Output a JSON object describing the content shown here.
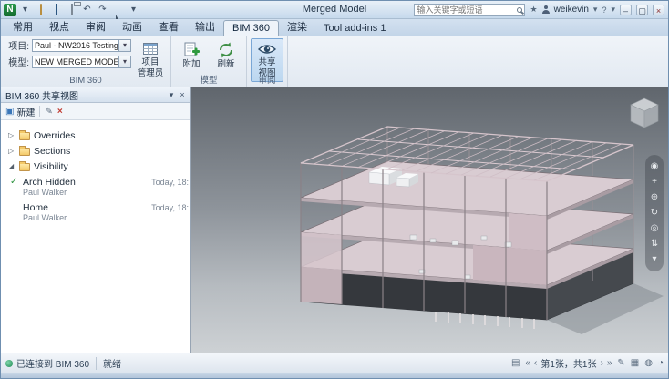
{
  "window": {
    "title": "Merged Model",
    "search_placeholder": "输入关键字或短语",
    "user": "weikevin",
    "help": "?",
    "logo": "N"
  },
  "tabs": {
    "items": [
      "常用",
      "视点",
      "审阅",
      "动画",
      "查看",
      "输出",
      "BIM 360",
      "渲染",
      "Tool add-ins 1"
    ]
  },
  "ribbon": {
    "project_label": "项目:",
    "project_value": "Paul - NW2016 Testing",
    "model_label": "模型:",
    "model_value": "NEW MERGED MODEL",
    "admin": {
      "line1": "项目",
      "line2": "管理员"
    },
    "attach": "附加",
    "refresh": "刷新",
    "shared": {
      "line1": "共享",
      "line2": "视图"
    },
    "groups": {
      "bim360": "BIM 360",
      "model": "模型",
      "review": "审阅"
    }
  },
  "panel": {
    "title": "BIM 360 共享视图",
    "new_label": "新建",
    "folders": [
      "Overrides",
      "Sections",
      "Visibility"
    ],
    "views": [
      {
        "name": "Arch Hidden",
        "author": "Paul Walker",
        "time": "Today, 18:"
      },
      {
        "name": "Home",
        "author": "Paul Walker",
        "time": "Today, 18:"
      }
    ]
  },
  "statusbar": {
    "connected": "已连接到 BIM 360",
    "ready": "就绪",
    "sheets": "第1张，共1张"
  },
  "icons": {
    "undo": "↶",
    "redo": "↷",
    "dropdown": "▾",
    "star": "★",
    "min": "–",
    "max": "▢",
    "close": "×",
    "panel_menu": "▾",
    "panel_close": "×",
    "new": "▣",
    "edit": "✎",
    "delete": "×",
    "collapsed": "▷",
    "expanded": "◢",
    "check": "✓",
    "sheet_list": "▤",
    "pager_first": "«",
    "pager_prev": "‹",
    "pager_next": "›",
    "pager_last": "»",
    "status_edit": "✎",
    "status_disk": "▦",
    "status_net": "◍",
    "status_speed": "◔",
    "nav": [
      "◉",
      "+",
      "⊕",
      "↻",
      "◎",
      "⇅",
      "▾"
    ]
  }
}
